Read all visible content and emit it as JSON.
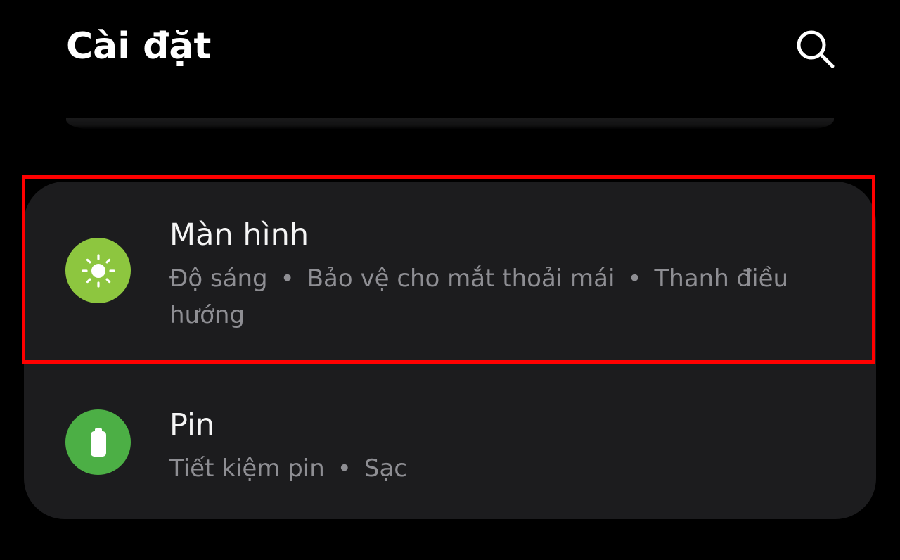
{
  "header": {
    "title": "Cài đặt",
    "search_icon": "search-icon"
  },
  "settings": {
    "display": {
      "title": "Màn hình",
      "icon": "brightness-sun-icon",
      "icon_color": "#8dc63f",
      "subtitle_parts": [
        "Độ sáng",
        "Bảo vệ cho mắt thoải mái",
        "Thanh điều hướng"
      ],
      "separator": "•"
    },
    "battery": {
      "title": "Pin",
      "icon": "battery-icon",
      "icon_color": "#4caf45",
      "subtitle_parts": [
        "Tiết kiệm pin",
        "Sạc"
      ],
      "separator": "•"
    }
  },
  "colors": {
    "background": "#000000",
    "card": "#1c1c1e",
    "title_text": "#ffffff",
    "subtitle_text": "#8e8e93",
    "highlight": "#ff0000"
  }
}
